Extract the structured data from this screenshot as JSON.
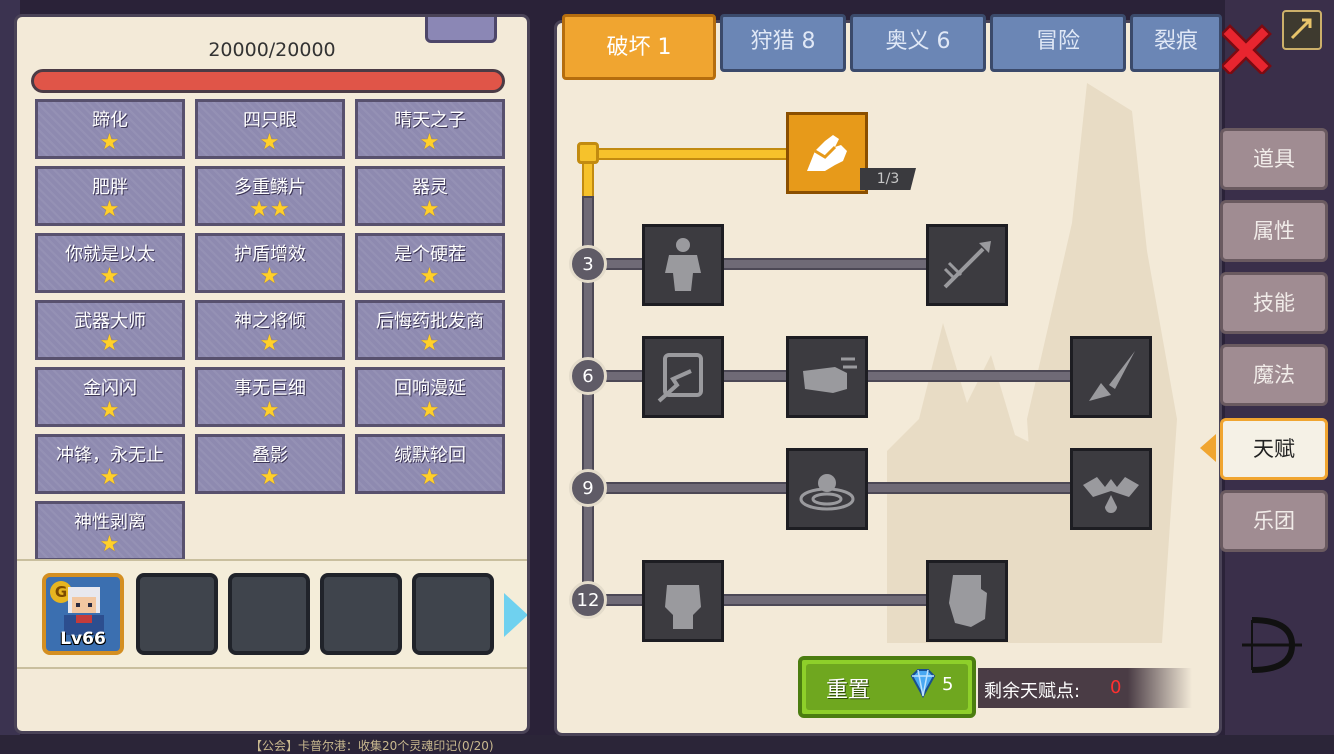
{
  "player": {
    "hp_text": "20000/20000",
    "hp_fraction": 1.0
  },
  "skills": [
    {
      "name": "蹄化",
      "stars": 1
    },
    {
      "name": "四只眼",
      "stars": 1
    },
    {
      "name": "晴天之子",
      "stars": 1
    },
    {
      "name": "肥胖",
      "stars": 1
    },
    {
      "name": "多重鳞片",
      "stars": 2
    },
    {
      "name": "器灵",
      "stars": 1
    },
    {
      "name": "你就是以太",
      "stars": 1
    },
    {
      "name": "护盾增效",
      "stars": 1
    },
    {
      "name": "是个硬茬",
      "stars": 1
    },
    {
      "name": "武器大师",
      "stars": 1
    },
    {
      "name": "神之将倾",
      "stars": 1
    },
    {
      "name": "后悔药批发商",
      "stars": 1
    },
    {
      "name": "金闪闪",
      "stars": 1
    },
    {
      "name": "事无巨细",
      "stars": 1
    },
    {
      "name": "回响漫延",
      "stars": 1
    },
    {
      "name": "冲锋，永无止",
      "stars": 1
    },
    {
      "name": "叠影",
      "stars": 1
    },
    {
      "name": "缄默轮回",
      "stars": 1
    },
    {
      "name": "神性剥离",
      "stars": 1
    }
  ],
  "team": {
    "hero_level": "Lv66",
    "hero_badge": "G",
    "empty_slots": 4
  },
  "category_tabs": [
    {
      "label": "破坏 1",
      "active": true
    },
    {
      "label": "狩猎 8",
      "active": false
    },
    {
      "label": "奥义 6",
      "active": false
    },
    {
      "label": "冒险",
      "active": false
    },
    {
      "label": "裂痕",
      "active": false
    }
  ],
  "talent_tree": {
    "tiers": [
      "3",
      "6",
      "9",
      "12"
    ],
    "top_node_count": "1/3",
    "icons": {
      "top": "arm-wrestle-icon",
      "t3a": "muscle-body-icon",
      "t3b": "arrow-hit-icon",
      "t6a": "shield-break-icon",
      "t6b": "fist-punch-icon",
      "t6c": "blade-slash-icon",
      "t9a": "ground-ripple-icon",
      "t9b": "bat-drop-icon",
      "t12a": "raised-fist-icon",
      "t12b": "grab-hand-icon"
    }
  },
  "reset": {
    "label": "重置",
    "cost": "5"
  },
  "remaining_points": {
    "label": "剩余天赋点:",
    "value": "0"
  },
  "side_tabs": [
    {
      "label": "道具",
      "active": false
    },
    {
      "label": "属性",
      "active": false
    },
    {
      "label": "技能",
      "active": false
    },
    {
      "label": "魔法",
      "active": false
    },
    {
      "label": "天赋",
      "active": true
    },
    {
      "label": "乐团",
      "active": false
    }
  ],
  "background": {
    "chat_line": "【公会】卡普尔港：收集20个灵魂印记(0/20)"
  },
  "colors": {
    "accent_gold": "#f0a530",
    "hp_red": "#e05548",
    "reset_green": "#8ecf2a",
    "remaining_red": "#ff3030"
  }
}
